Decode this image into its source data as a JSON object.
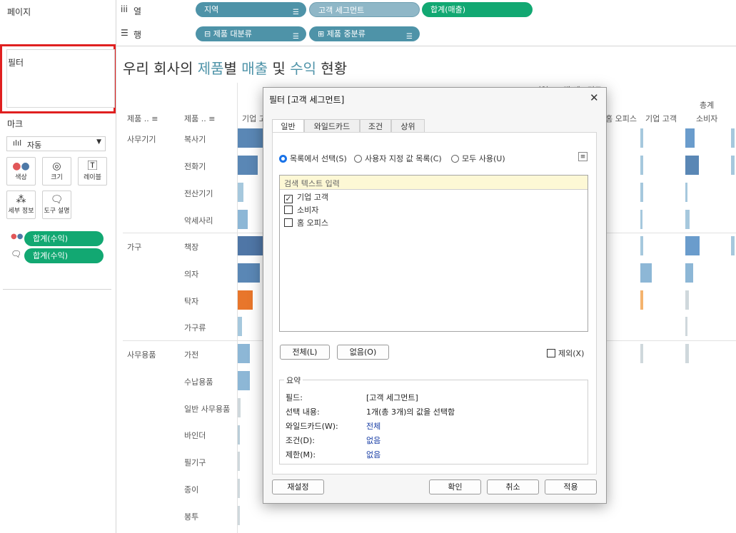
{
  "left_panel": {
    "pages_label": "페이지",
    "filters_label": "필터",
    "marks_label": "마크",
    "mark_type": "자동",
    "mark_buttons": [
      "색상",
      "크기",
      "레이블",
      "세부 정보",
      "도구 설명"
    ],
    "mark_pills": [
      "합계(수익)",
      "합계(수익)"
    ]
  },
  "shelves": {
    "columns_label": "열",
    "rows_label": "행",
    "columns": [
      "지역",
      "고객 세그먼트",
      "합계(매출)"
    ],
    "rows": [
      "제품 대분류",
      "제품 중분류"
    ]
  },
  "view": {
    "title_parts": [
      "우리 회사의 ",
      "제품",
      "별 ",
      "매출",
      " 및 ",
      "수익",
      " 현황"
    ],
    "header_top": "지역 / 고객 세그먼트",
    "header_total": "총계",
    "col_header1": "제품 ..",
    "col_header2": "제품 ..",
    "col_segment1": "기업 고",
    "col_segment_right1": "홈 오피스",
    "col_segment_right2": "기업 고객",
    "col_segment_right3": "소비자",
    "categories": [
      {
        "name": "사무기기",
        "items": [
          "복사기",
          "전화기",
          "전산기기",
          "악세사리"
        ]
      },
      {
        "name": "가구",
        "items": [
          "책장",
          "의자",
          "탁자",
          "가구류"
        ]
      },
      {
        "name": "사무용품",
        "items": [
          "가전",
          "수납용품",
          "일반 사무용품",
          "바인더",
          "필기구",
          "종이",
          "봉투"
        ]
      }
    ]
  },
  "dialog": {
    "title": "필터 [고객 세그먼트]",
    "tabs": [
      "일반",
      "와일드카드",
      "조건",
      "상위"
    ],
    "radio_options": [
      "목록에서 선택(S)",
      "사용자 지정 값 목록(C)",
      "모두 사용(U)"
    ],
    "search_placeholder": "검색 텍스트 입력",
    "items": [
      {
        "label": "기업 고객",
        "checked": true
      },
      {
        "label": "소비자",
        "checked": false
      },
      {
        "label": "홈 오피스",
        "checked": false
      }
    ],
    "all_button": "전체(L)",
    "none_button": "없음(O)",
    "exclude_label": "제외(X)",
    "summary_title": "요약",
    "summary": [
      {
        "key": "필드:",
        "value": "[고객 세그먼트]",
        "link": false
      },
      {
        "key": "선택 내용:",
        "value": "1개(총 3개)의 값을 선택함",
        "link": false
      },
      {
        "key": "와일드카드(W):",
        "value": "전체",
        "link": true
      },
      {
        "key": "조건(D):",
        "value": "없음",
        "link": true
      },
      {
        "key": "제한(M):",
        "value": "없음",
        "link": true
      }
    ],
    "reset_button": "재설정",
    "ok_button": "확인",
    "cancel_button": "취소",
    "apply_button": "적용"
  },
  "colors": {
    "accent_title": "#4e93a8",
    "filter_highlight": "#e02020"
  }
}
